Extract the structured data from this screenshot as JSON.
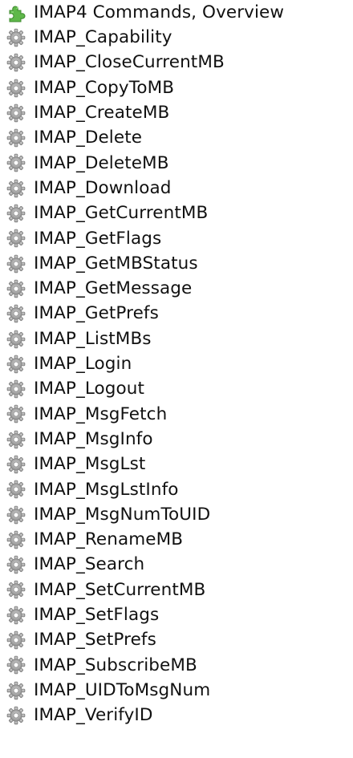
{
  "tree": {
    "header": {
      "label": "IMAP4 Commands, Overview",
      "icon": "puzzle-piece-icon",
      "icon_color": "#5fb84a"
    },
    "command_icon": "gear-icon",
    "command_icon_color": "#a8a8a8",
    "items": [
      "IMAP_Capability",
      "IMAP_CloseCurrentMB",
      "IMAP_CopyToMB",
      "IMAP_CreateMB",
      "IMAP_Delete",
      "IMAP_DeleteMB",
      "IMAP_Download",
      "IMAP_GetCurrentMB",
      "IMAP_GetFlags",
      "IMAP_GetMBStatus",
      "IMAP_GetMessage",
      "IMAP_GetPrefs",
      "IMAP_ListMBs",
      "IMAP_Login",
      "IMAP_Logout",
      "IMAP_MsgFetch",
      "IMAP_MsgInfo",
      "IMAP_MsgLst",
      "IMAP_MsgLstInfo",
      "IMAP_MsgNumToUID",
      "IMAP_RenameMB",
      "IMAP_Search",
      "IMAP_SetCurrentMB",
      "IMAP_SetFlags",
      "IMAP_SetPrefs",
      "IMAP_SubscribeMB",
      "IMAP_UIDToMsgNum",
      "IMAP_VerifyID"
    ]
  }
}
